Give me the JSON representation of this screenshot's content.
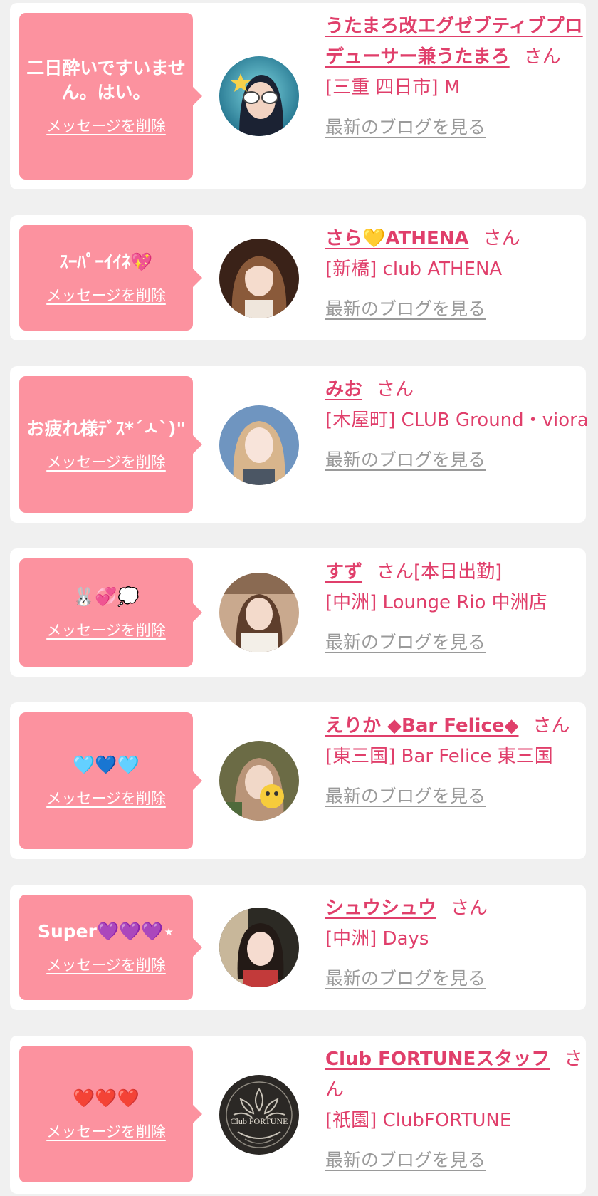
{
  "colors": {
    "page_background": "#f0f0f0",
    "card_background": "#ffffff",
    "bubble_pink": "#fc929f",
    "accent_text": "#e03f6b",
    "link_gray": "#9a9a9a"
  },
  "items": [
    {
      "message": "二日酔いですいません。はい。",
      "delete_label": "メッセージを削除",
      "name": "うたまろ改エグゼブティブプロデューサー兼うたまろ",
      "honorific": "さん",
      "badge": "",
      "shop": "[三重 四日市] M",
      "blog_label": "最新のブログを見る",
      "avatar_icon": "user-photo-icon"
    },
    {
      "message": "ｽｰﾊﾟｰｲｲﾈ💖",
      "delete_label": "メッセージを削除",
      "name": "さら💛ATHENA",
      "honorific": "さん",
      "badge": "",
      "shop": "[新橋] club ATHENA",
      "blog_label": "最新のブログを見る",
      "avatar_icon": "user-photo-icon"
    },
    {
      "message": "お疲れ様ﾃﾞｽ*´ㅅ`)\"",
      "delete_label": "メッセージを削除",
      "name": "みお",
      "honorific": "さん",
      "badge": "",
      "shop": "[木屋町] CLUB Ground・viora",
      "blog_label": "最新のブログを見る",
      "avatar_icon": "user-photo-icon"
    },
    {
      "message": "🐰💞💭",
      "delete_label": "メッセージを削除",
      "name": "すず",
      "honorific": "さん",
      "badge": "[本日出勤]",
      "shop": "[中洲] Lounge Rio 中洲店",
      "blog_label": "最新のブログを見る",
      "avatar_icon": "user-photo-icon"
    },
    {
      "message": "🩵💙🩵",
      "delete_label": "メッセージを削除",
      "name": "えりか ◆Bar Felice◆",
      "honorific": "さん",
      "badge": "",
      "shop": "[東三国] Bar Felice 東三国",
      "blog_label": "最新のブログを見る",
      "avatar_icon": "user-photo-icon"
    },
    {
      "message": "Super💜💜💜⋆",
      "delete_label": "メッセージを削除",
      "name": "シュウシュウ",
      "honorific": "さん",
      "badge": "",
      "shop": "[中洲] Days",
      "blog_label": "最新のブログを見る",
      "avatar_icon": "user-photo-icon"
    },
    {
      "message": "❤️❤️❤️",
      "delete_label": "メッセージを削除",
      "name": "Club FORTUNEスタッフ",
      "honorific": "さん",
      "badge": "",
      "shop": "[祇園] ClubFORTUNE",
      "blog_label": "最新のブログを見る",
      "avatar_icon": "club-logo-icon",
      "avatar_logo_text": "Club FORTUNE"
    }
  ]
}
